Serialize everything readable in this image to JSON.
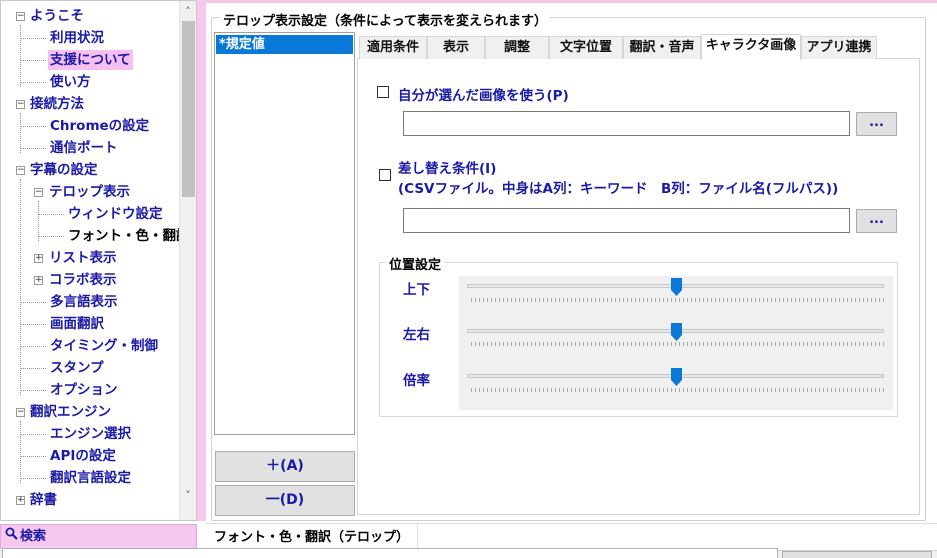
{
  "tree": {
    "items": [
      {
        "label": "ようこそ"
      },
      {
        "label": "利用状況"
      },
      {
        "label": "支援について"
      },
      {
        "label": "使い方"
      },
      {
        "label": "接続方法"
      },
      {
        "label": "Chromeの設定"
      },
      {
        "label": "通信ポート"
      },
      {
        "label": "字幕の設定"
      },
      {
        "label": "テロップ表示"
      },
      {
        "label": "ウィンドウ設定"
      },
      {
        "label": "フォント・色・翻訳"
      },
      {
        "label": "リスト表示"
      },
      {
        "label": "コラボ表示"
      },
      {
        "label": "多言語表示"
      },
      {
        "label": "画面翻訳"
      },
      {
        "label": "タイミング・制御"
      },
      {
        "label": "スタンプ"
      },
      {
        "label": "オプション"
      },
      {
        "label": "翻訳エンジン"
      },
      {
        "label": "エンジン選択"
      },
      {
        "label": "APIの設定"
      },
      {
        "label": "翻訳言語設定"
      },
      {
        "label": "辞書"
      }
    ],
    "scroll_up": "˄",
    "scroll_down": "˅"
  },
  "search": {
    "icon": "magnifier-icon",
    "label": "検索"
  },
  "group": {
    "title": "テロップ表示設定（条件によって表示を変えられます）"
  },
  "presets": {
    "items": [
      "*規定値"
    ],
    "add_label": "＋(A)",
    "remove_label": "一(D)"
  },
  "tabs": [
    "適用条件",
    "表示",
    "調整",
    "文字位置",
    "翻訳・音声",
    "キャラクタ画像",
    "アプリ連携"
  ],
  "active_tab": "キャラクタ画像",
  "character_image": {
    "use_own_image_label": "自分が選んだ画像を使う(P)",
    "use_own_image_checked": false,
    "image_path_value": "",
    "browse_label": "...",
    "replace_label_line1": "差し替え条件(I)",
    "replace_label_line2": "(CSVファイル。中身はA列：キーワード　B列：ファイル名(フルパス))",
    "replace_checked": false,
    "csv_path_value": "",
    "browse2_label": "..."
  },
  "position": {
    "title": "位置設定",
    "sliders": [
      {
        "label": "上下",
        "value": 0.5
      },
      {
        "label": "左右",
        "value": 0.5
      },
      {
        "label": "倍率",
        "value": 0.5
      }
    ]
  },
  "status": {
    "breadcrumb": "フォント・色・翻訳（テロップ）"
  },
  "colors": {
    "accent_pink": "#f8c8ec",
    "link_blue": "#1a1aa6",
    "selection_blue": "#0a78d7",
    "slider_thumb": "#0a78d7"
  }
}
